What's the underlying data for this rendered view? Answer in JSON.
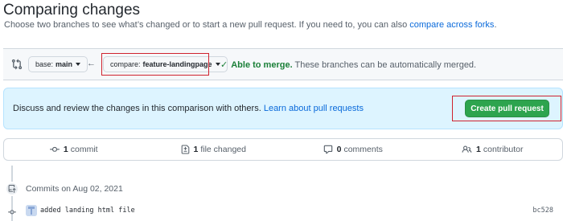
{
  "header": {
    "title": "Comparing changes",
    "subtitle": "Choose two branches to see what’s changed or to start a new pull request. If you need to, you can also ",
    "subtitle_link": "compare across forks",
    "subtitle_end": "."
  },
  "range": {
    "base_prefix": "base:",
    "base_branch": "main",
    "compare_prefix": "compare:",
    "compare_branch": "feature-landingpage",
    "merge_status": "Able to merge.",
    "merge_detail": " These branches can be automatically merged."
  },
  "flash": {
    "text": "Discuss and review the changes in this comparison with others. ",
    "link": "Learn about pull requests",
    "button": "Create pull request"
  },
  "stats": {
    "commits_count": "1",
    "commits_label": "commit",
    "files_count": "1",
    "files_label": "file changed",
    "comments_count": "0",
    "comments_label": "comments",
    "contributors_count": "1",
    "contributors_label": "contributor"
  },
  "timeline": {
    "date_label": "Commits on Aug 02, 2021",
    "commits": [
      {
        "message": "added landing html file",
        "sha": "bc528"
      }
    ]
  },
  "colors": {
    "accent": "#0969da",
    "success": "#2da44e",
    "highlight": "#cf222e",
    "flash_bg": "#ddf4ff"
  },
  "icons": [
    "git-compare-icon",
    "arrow-left-icon",
    "check-icon",
    "git-commit-icon",
    "file-diff-icon",
    "comment-icon",
    "people-icon",
    "repo-push-icon",
    "avatar"
  ]
}
